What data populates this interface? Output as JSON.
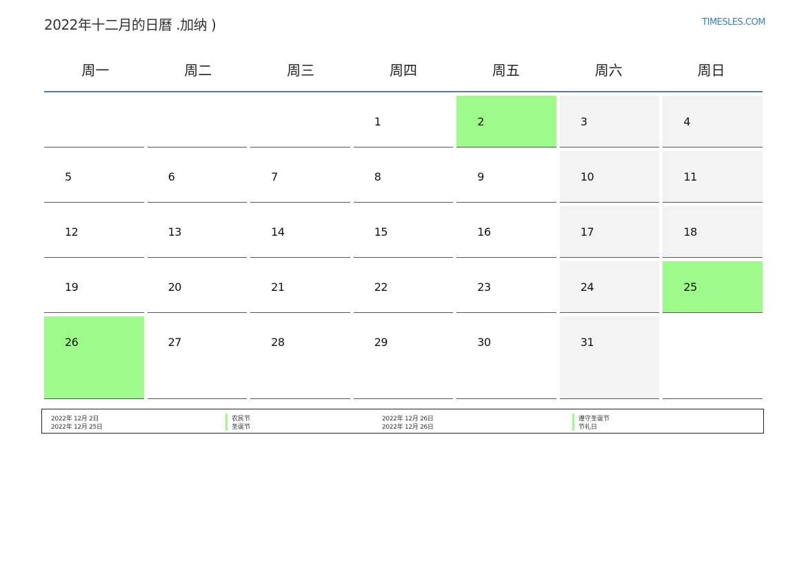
{
  "header": {
    "title": "2022年十二月的日曆 .加纳 )",
    "site": "TIMESLES.COM"
  },
  "weekdays": [
    "周一",
    "周二",
    "周三",
    "周四",
    "周五",
    "周六",
    "周日"
  ],
  "calendar": {
    "weeks": [
      [
        "",
        "",
        "",
        "1",
        "2",
        "3",
        "4"
      ],
      [
        "5",
        "6",
        "7",
        "8",
        "9",
        "10",
        "11"
      ],
      [
        "12",
        "13",
        "14",
        "15",
        "16",
        "17",
        "18"
      ],
      [
        "19",
        "20",
        "21",
        "22",
        "23",
        "24",
        "25"
      ],
      [
        "26",
        "27",
        "28",
        "29",
        "30",
        "31",
        ""
      ]
    ],
    "holidays": [
      "2",
      "25",
      "26"
    ]
  },
  "colors": {
    "holiday": "#9dfb8a",
    "weekend": "#f3f3f3",
    "header_rule": "#5b7aa0",
    "link": "#3a7cc4"
  },
  "legend": {
    "left_dates": [
      "2022年 12月 2日",
      "2022年 12月 25日"
    ],
    "left_names": [
      "农民节",
      "圣诞节"
    ],
    "right_dates": [
      "2022年 12月 26日",
      "2022年 12月 26日"
    ],
    "right_names": [
      "遵守圣诞节",
      "节礼日"
    ]
  }
}
